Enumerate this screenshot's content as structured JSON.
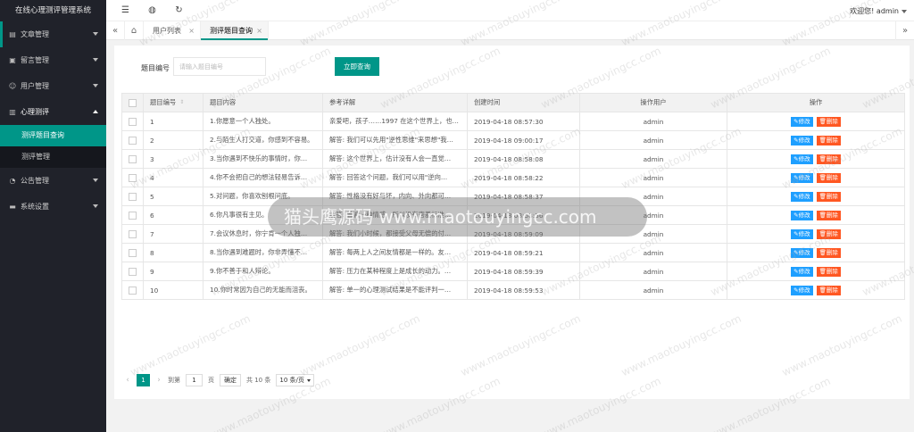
{
  "app": {
    "title": "在线心理测评管理系统"
  },
  "header": {
    "welcome": "欢迎您! admin"
  },
  "sidebar": {
    "items": [
      {
        "icon": "book-icon",
        "label": "文章管理"
      },
      {
        "icon": "message-icon",
        "label": "留言管理"
      },
      {
        "icon": "user-icon",
        "label": "用户管理"
      },
      {
        "icon": "brain-icon",
        "label": "心理测评"
      },
      {
        "icon": "announce-icon",
        "label": "公告管理"
      },
      {
        "icon": "settings-icon",
        "label": "系统设置"
      }
    ],
    "sub_items": [
      "测评题目查询",
      "测评管理"
    ]
  },
  "tabs": [
    {
      "label": "用户列表"
    },
    {
      "label": "测评题目查询"
    }
  ],
  "search": {
    "label": "题目编号",
    "placeholder": "请输入题目编号",
    "button": "立即查询"
  },
  "table": {
    "headers": [
      "题目编号",
      "题目内容",
      "参考详解",
      "创建时间",
      "操作用户",
      "操作"
    ],
    "edit_label": "✎修改",
    "delete_label": "🗑删除",
    "rows": [
      {
        "id": "1",
        "content": "1.你愿意一个人独处。",
        "answer": "亲爱吧，孩子……1997 在这个世界上，也许…",
        "time": "2019-04-18 08:57:30",
        "user": "admin"
      },
      {
        "id": "2",
        "content": "2.与陌生人打交道，你感到不容易。",
        "answer": "解答: 我们可以先用\"逆性思维\"来思想\"我…",
        "time": "2019-04-18 09:00:17",
        "user": "admin"
      },
      {
        "id": "3",
        "content": "3.当你遇到不快乐的事情时，你…",
        "answer": "解答: 这个世界上，估计没有人会一直觉…",
        "time": "2019-04-18 08:58:08",
        "user": "admin"
      },
      {
        "id": "4",
        "content": "4.你不会把自己的想法轻易告诉…",
        "answer": "解答: 回答这个问题，我们可以用\"逆向…",
        "time": "2019-04-18 08:58:22",
        "user": "admin"
      },
      {
        "id": "5",
        "content": "5.对问题，你喜欢刨根问底。",
        "answer": "解答: 性格没有好与坏，内向、外向都可…",
        "time": "2019-04-18 08:58:37",
        "user": "admin"
      },
      {
        "id": "6",
        "content": "6.你凡事很有主见。",
        "answer": "解答: 普遍一种情感，所以没有害羞标准…",
        "time": "2019-04-18 08:58:56",
        "user": "admin"
      },
      {
        "id": "7",
        "content": "7.会议休息时，你宁肯一个人独…",
        "answer": "解答: 我们小时候，都接受父母无偿的付…",
        "time": "2019-04-18 08:59:09",
        "user": "admin"
      },
      {
        "id": "8",
        "content": "8.当你遇到难题时，你非弄懂不…",
        "answer": "解答: 每两上人之间友情都是一样的。友…",
        "time": "2019-04-18 08:59:21",
        "user": "admin"
      },
      {
        "id": "9",
        "content": "9.你不善于和人辩论。",
        "answer": "解答: 压力在某种程度上是成长的动力。…",
        "time": "2019-04-18 08:59:39",
        "user": "admin"
      },
      {
        "id": "10",
        "content": "10.你时常因为自己的无能而沮丧。",
        "answer": "解答: 单一的心理测试结果是不能评判一…",
        "time": "2019-04-18 08:59:53",
        "user": "admin"
      }
    ]
  },
  "pager": {
    "current": "1",
    "goto_label": "到第",
    "goto_value": "1",
    "page_unit": "页",
    "confirm": "确定",
    "total": "共 10 条",
    "page_size": "10 条/页"
  },
  "watermark": {
    "text": "猫头鹰源码",
    "site": "www.maotouyingcc.com"
  },
  "colors": {
    "accent": "#009688",
    "sidebar_bg": "#20222a",
    "edit": "#1e9fff",
    "delete": "#ff5722"
  }
}
